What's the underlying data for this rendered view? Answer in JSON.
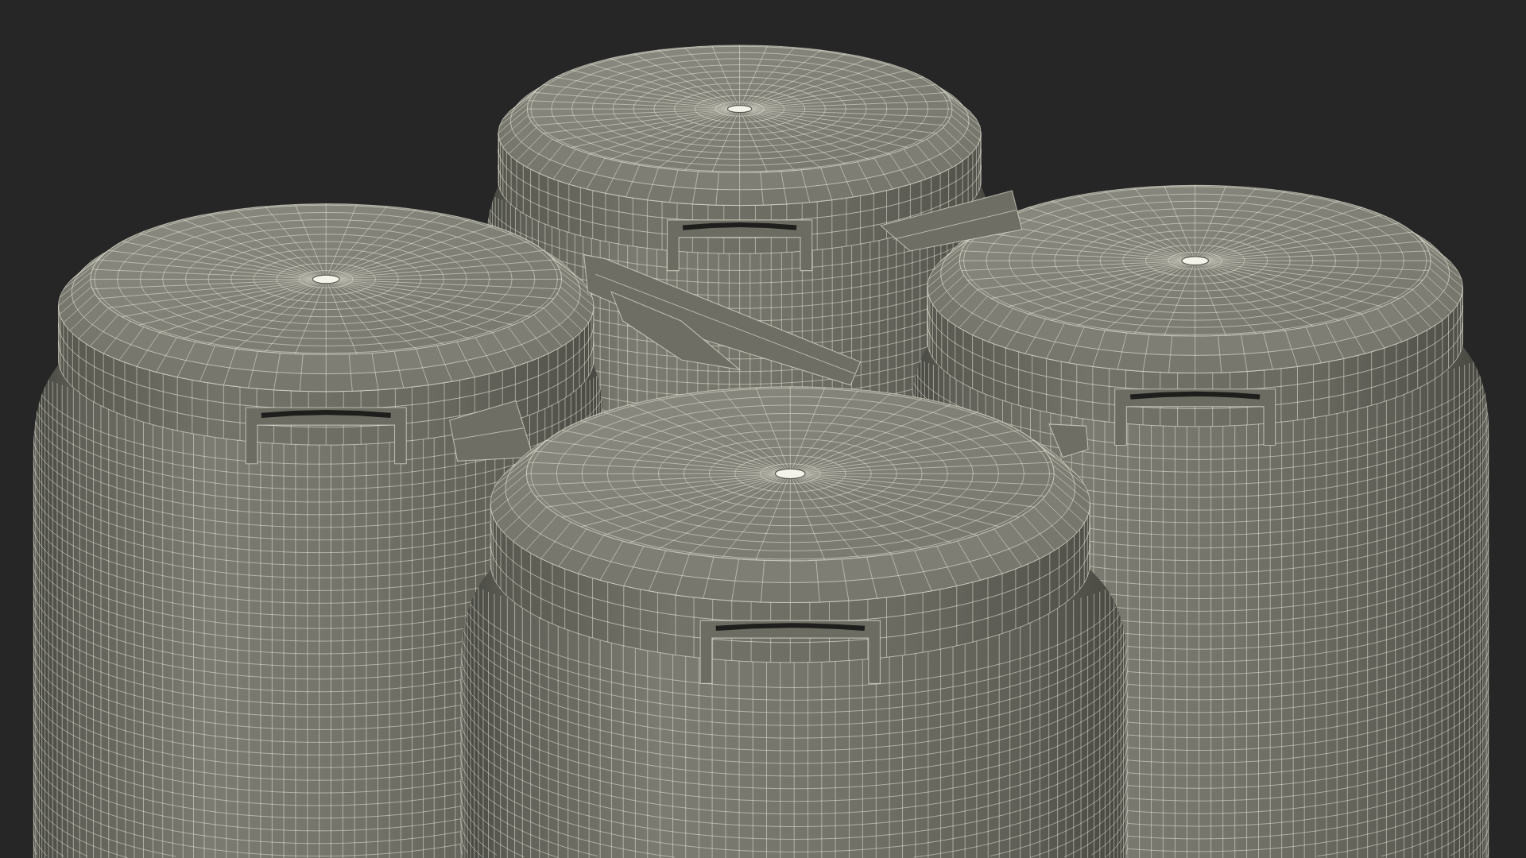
{
  "scene": {
    "objects": [
      {
        "kind": "can"
      },
      {
        "kind": "can"
      },
      {
        "kind": "can"
      },
      {
        "kind": "carrier"
      },
      {
        "kind": "can"
      }
    ]
  }
}
